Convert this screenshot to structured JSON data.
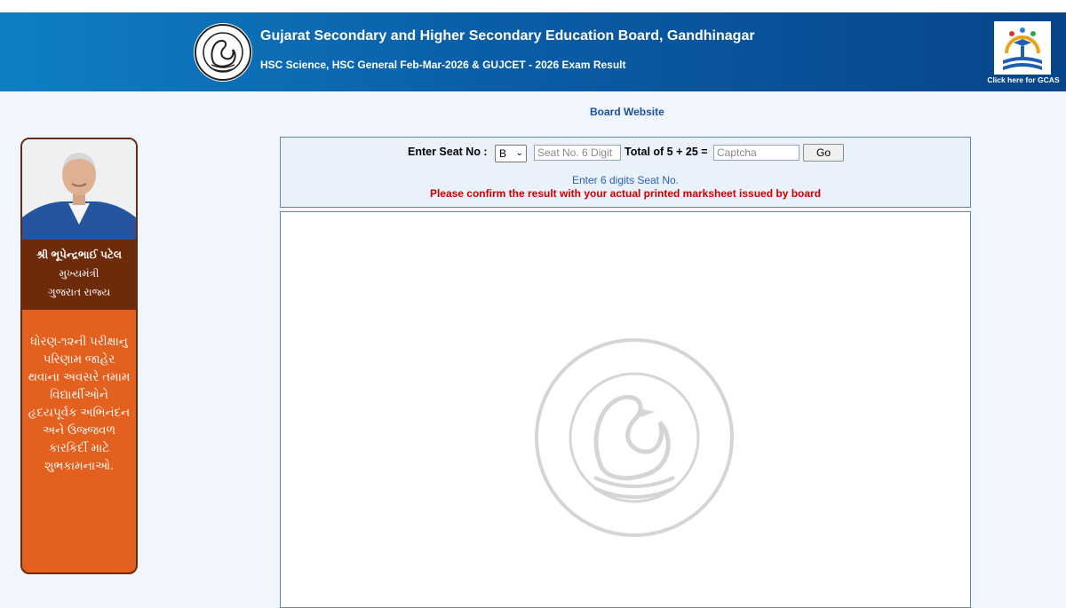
{
  "header": {
    "title": "Gujarat Secondary and Higher Secondary Education Board, Gandhinagar",
    "subtitle": "HSC Science, HSC General Feb-Mar-2026 & GUJCET - 2026 Exam Result",
    "gcas_label": "Click here for GCAS"
  },
  "nav": {
    "board_website": "Board Website"
  },
  "sidebar": {
    "cm_name": "શ્રી ભૂપેન્દ્રભાઈ પટેલ",
    "cm_role": "મુખ્યમંત્રી",
    "cm_state": "ગુજરાત રાજ્ય",
    "message": "ધોરણ-૧૨ની પરીક્ષાનુ પરિણામ જાહેર થવાના અવસરે તમામ વિદ્યાર્થીઓને હૃદયપૂર્વક અભિનંદન અને ઉજ્જવળ કારકિર્દી માટે શુભકામનાઓ."
  },
  "form": {
    "seat_label": "Enter Seat No :",
    "series_selected": "B",
    "seat_placeholder": "Seat No. 6 Digit",
    "captcha_label": "Total of 5 + 25 =",
    "captcha_placeholder": "Captcha",
    "go_label": "Go",
    "hint": "Enter 6 digits Seat No.",
    "warning": "Please confirm the result with your actual printed marksheet issued by board"
  },
  "icons": {
    "header_seal": "board-seal-icon",
    "gcas": "gcas-logo-icon",
    "watermark": "board-seal-watermark-icon"
  },
  "colors": {
    "header_start": "#0f7fc4",
    "header_end": "#07458a",
    "sidebar_orange": "#e4601e",
    "sidebar_brown": "#6e2b0c",
    "warning_red": "#cc0000"
  }
}
